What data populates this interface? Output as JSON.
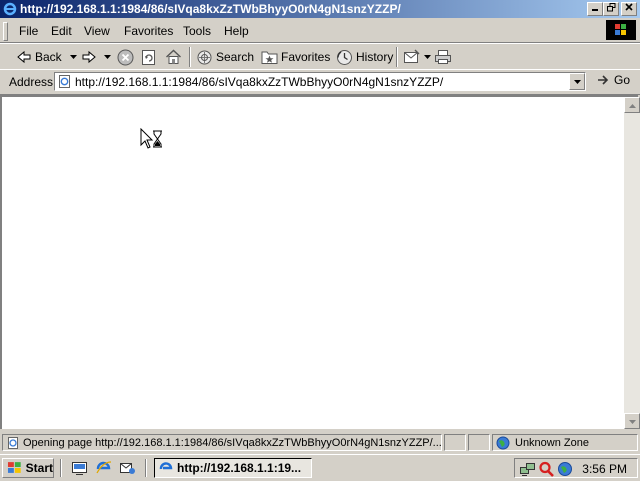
{
  "window": {
    "title": "http://192.168.1.1:1984/86/sIVqa8kxZzTWbBhyyO0rN4gN1snzYZZP/",
    "controls": [
      "minimize",
      "maximize",
      "close"
    ]
  },
  "menu": {
    "items": [
      "File",
      "Edit",
      "View",
      "Favorites",
      "Tools",
      "Help"
    ]
  },
  "toolbar": {
    "back_label": "Back",
    "search_label": "Search",
    "favorites_label": "Favorites",
    "history_label": "History"
  },
  "address": {
    "label": "Address",
    "url": "http://192.168.1.1:1984/86/sIVqa8kxZzTWbBhyyO0rN4gN1snzYZZP/",
    "go_label": "Go"
  },
  "statusbar": {
    "text": "Opening page http://192.168.1.1:1984/86/sIVqa8kxZzTWbBhyyO0rN4gN1snzYZZP/...",
    "zone": "Unknown Zone"
  },
  "taskbar": {
    "start_label": "Start",
    "task_label": "http://192.168.1.1:19...",
    "clock": "3:56 PM"
  },
  "colors": {
    "titlebar_start": "#0a246a",
    "titlebar_end": "#a6caf0",
    "chrome": "#d4d0c8"
  }
}
